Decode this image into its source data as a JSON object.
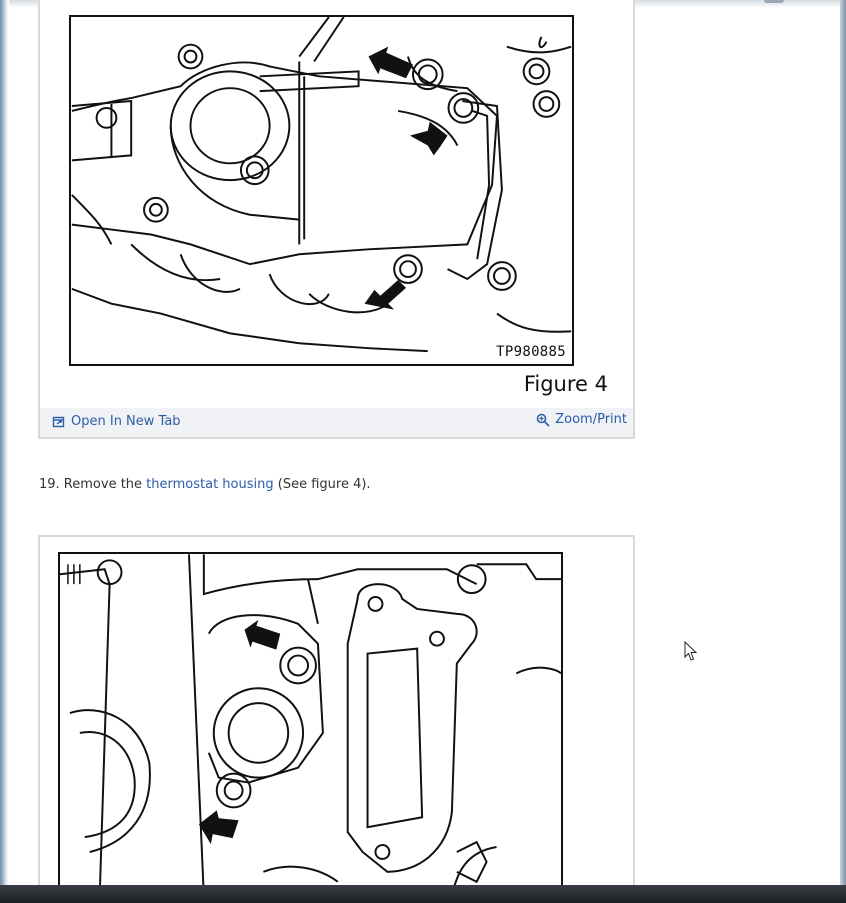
{
  "figures": [
    {
      "figure_id": "TP980885",
      "caption": "Figure 4",
      "open_tab_label": "Open In New Tab",
      "zoom_label": "Zoom/Print",
      "open_icon": "open-new-tab-icon",
      "zoom_icon": "magnifier-icon"
    },
    {
      "figure_id": "",
      "caption": ""
    }
  ],
  "step": {
    "prefix": "19. Remove the ",
    "link_text": "thermostat housing",
    "suffix": " (See figure 4)."
  },
  "colors": {
    "link": "#2a5da8",
    "toolbar_bg": "#f1f2f5",
    "card_border": "#d9d9d9"
  }
}
